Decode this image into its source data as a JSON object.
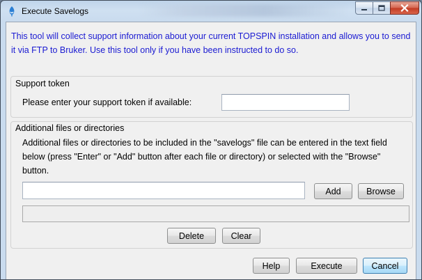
{
  "window": {
    "title": "Execute Savelogs",
    "title_icon": "topspin-app-icon",
    "controls": [
      "minimize-icon",
      "maximize-icon",
      "close-icon"
    ]
  },
  "intro_text": "This tool will collect support information about your current TOPSPIN installation and allows you to send it via FTP to Bruker. Use this tool only if you have been instructed to do so.",
  "support_token": {
    "group_title": "Support token",
    "prompt": "Please enter your support token if available:",
    "value": ""
  },
  "additional_files": {
    "group_title": "Additional files or directories",
    "description": "Additional files or directories to be included in the \"savelogs\" file can be entered in the text field below (press \"Enter\" or \"Add\" button after each file or directory) or selected with the \"Browse\" button.",
    "path_value": "",
    "add_label": "Add",
    "browse_label": "Browse",
    "list_items": [],
    "delete_label": "Delete",
    "clear_label": "Clear"
  },
  "footer": {
    "help_label": "Help",
    "execute_label": "Execute",
    "cancel_label": "Cancel"
  },
  "colors": {
    "intro_text": "#1a1ad2",
    "close_button": "#c23a22",
    "default_button_border": "#3c7fb1"
  }
}
